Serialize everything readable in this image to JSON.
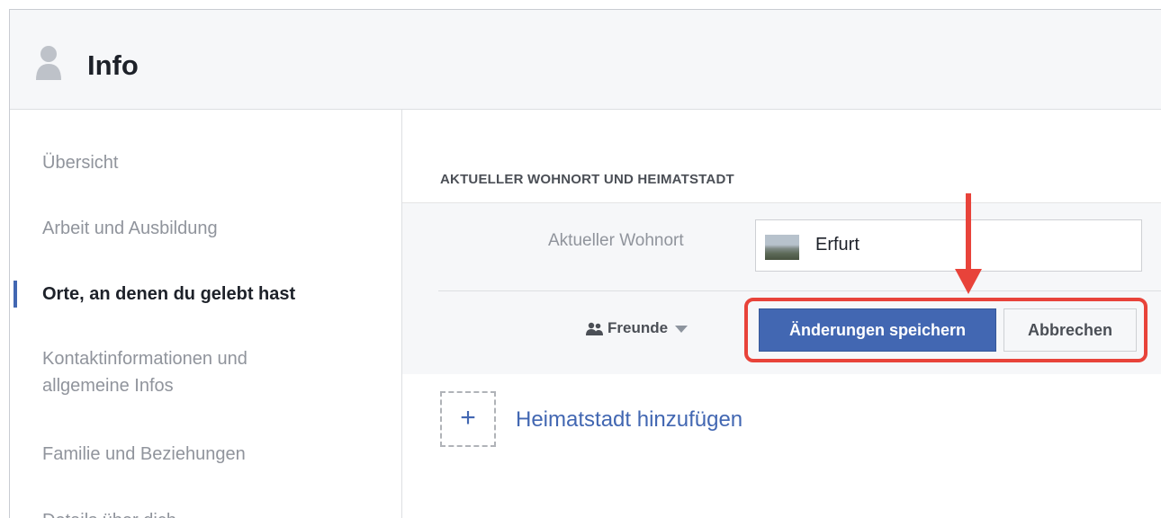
{
  "header": {
    "title": "Info",
    "icon": "person-icon"
  },
  "sidebar": {
    "items": [
      {
        "label": "Übersicht"
      },
      {
        "label": "Arbeit und Ausbildung"
      },
      {
        "label": "Orte, an denen du gelebt hast",
        "active": true
      },
      {
        "label_line1": "Kontaktinformationen und",
        "label_line2": "allgemeine Infos"
      },
      {
        "label": "Familie und Beziehungen"
      },
      {
        "label": "Details über dich"
      }
    ]
  },
  "section": {
    "title": "AKTUELLER WOHNORT UND HEIMATSTADT",
    "current_city_label": "Aktueller Wohnort",
    "current_city_value": "Erfurt",
    "privacy_label": "Freunde",
    "save_label": "Änderungen speichern",
    "cancel_label": "Abbrechen",
    "add_hometown_label": "Heimatstadt hinzufügen",
    "add_icon": "+"
  },
  "colors": {
    "accent": "#4267b2",
    "highlight": "#e8433a",
    "header_bg": "#f6f7f9"
  }
}
